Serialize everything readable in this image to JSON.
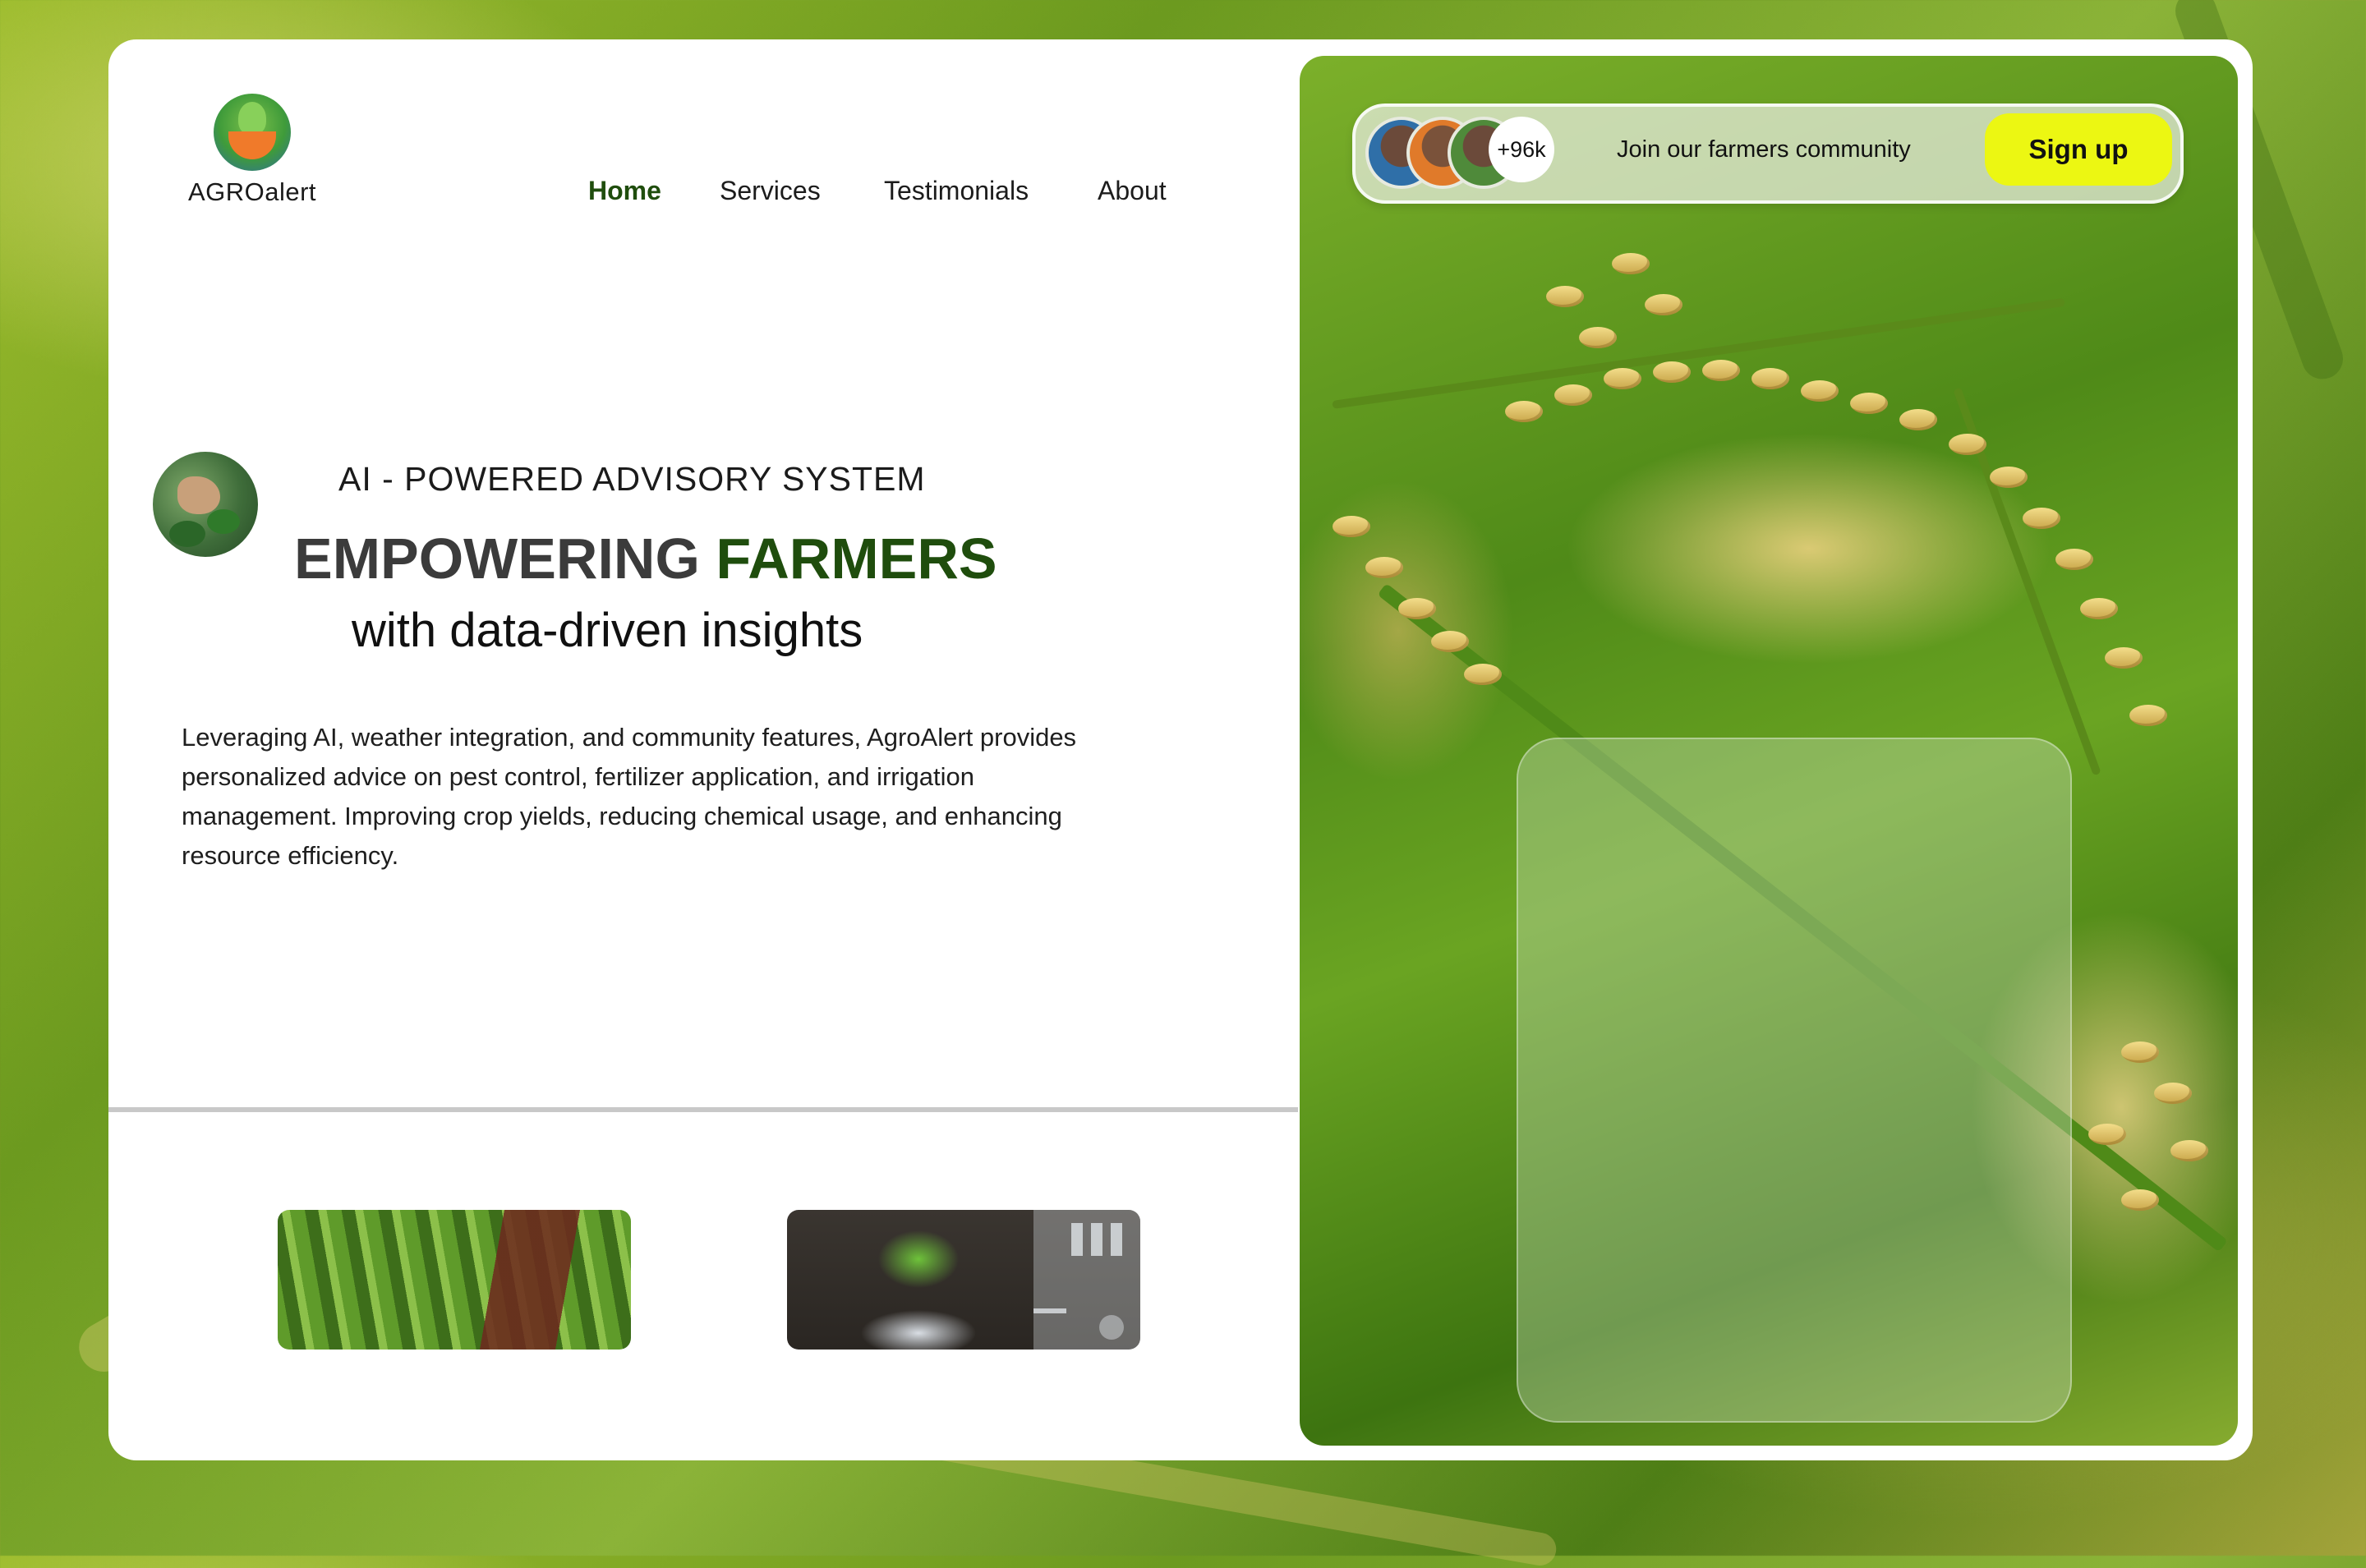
{
  "brand": {
    "name": "AGROalert",
    "logo_icon": "agroalert-logo-icon"
  },
  "nav": {
    "items": [
      {
        "label": "Home",
        "active": true
      },
      {
        "label": "Services",
        "active": false
      },
      {
        "label": "Testimonials",
        "active": false
      },
      {
        "label": "About",
        "active": false
      }
    ]
  },
  "hero": {
    "eyebrow": "AI - POWERED ADVISORY SYSTEM",
    "headline_part1": "EMPOWERING ",
    "headline_part2": "FARMERS",
    "subheadline": "with data-driven insights",
    "description": "Leveraging AI, weather integration, and community features, AgroAlert provides personalized advice on pest control, fertilizer application, and irrigation management. Improving crop yields, reducing chemical usage, and enhancing resource efficiency."
  },
  "community": {
    "member_count": "+96k",
    "join_text": "Join our farmers community",
    "signup_label": "Sign up"
  },
  "colors": {
    "brand_green": "#1f4d0d",
    "signup_yellow": "#ecf712",
    "card_background": "#ffffff"
  },
  "icons": {
    "hero_avatar": "farmer-hand-photo",
    "thumbnail_1": "corn-field-photo",
    "thumbnail_2": "seedling-analytics-photo",
    "background": "rice-field-photo"
  }
}
